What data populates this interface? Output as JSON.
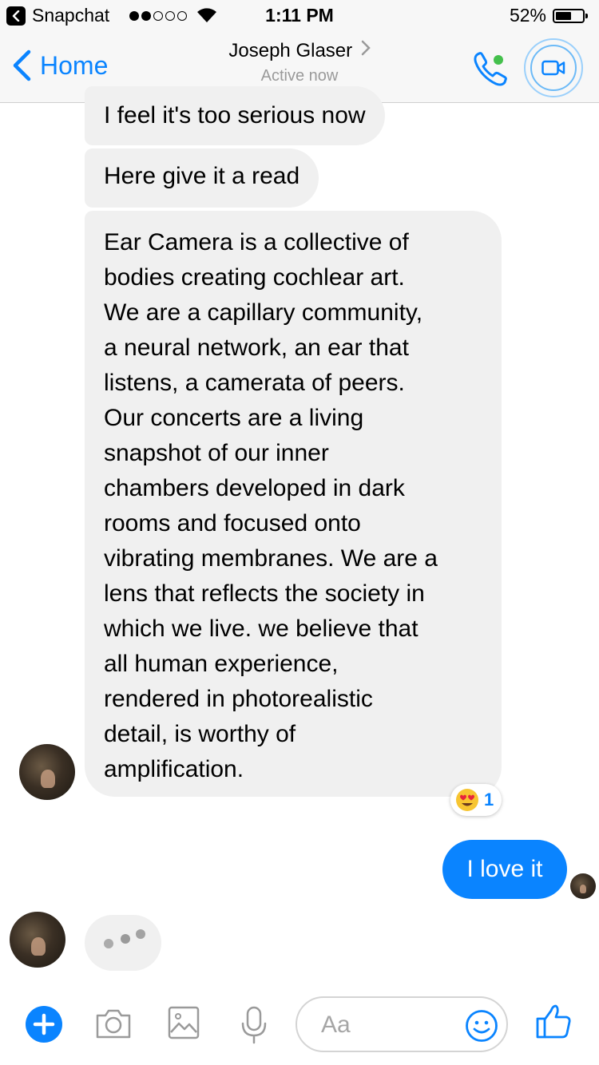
{
  "status_bar": {
    "app_name": "Snapchat",
    "time": "1:11 PM",
    "battery": "52%",
    "battery_level": 0.52,
    "signal_bars_filled": 2,
    "signal_bars_total": 5
  },
  "nav": {
    "back_label": "Home",
    "title": "Joseph Glaser",
    "subtitle": "Active now"
  },
  "messages": [
    {
      "text": "I feel it's too serious now"
    },
    {
      "text": "Here give it a read"
    },
    {
      "lines": [
        "Ear Camera is a collective of",
        "bodies creating cochlear art.",
        "We are a capillary community,",
        "a neural network, an ear that",
        "listens, a camerata of peers.",
        "Our concerts are a living",
        "snapshot of our inner",
        "chambers developed in dark",
        "rooms and focused onto",
        "vibrating membranes. We are a",
        "lens that reflects the society in",
        "which we live. we believe that",
        "all human experience,",
        "rendered in photorealistic",
        "detail, is worthy of",
        "amplification."
      ]
    }
  ],
  "reaction": {
    "emoji": "heart-eyes-emoji",
    "count": "1"
  },
  "outgoing_message": {
    "text": "I love it"
  },
  "composer": {
    "placeholder": "Aa"
  },
  "colors": {
    "accent": "#0a84ff",
    "incoming_bubble": "#f0f0f0",
    "active_indicator": "#44c04c"
  },
  "icons": [
    "back-chevron-icon",
    "wifi-icon",
    "phone-icon",
    "video-camera-icon",
    "plus-icon",
    "camera-icon",
    "image-icon",
    "microphone-icon",
    "smiley-icon",
    "thumbs-up-icon"
  ]
}
